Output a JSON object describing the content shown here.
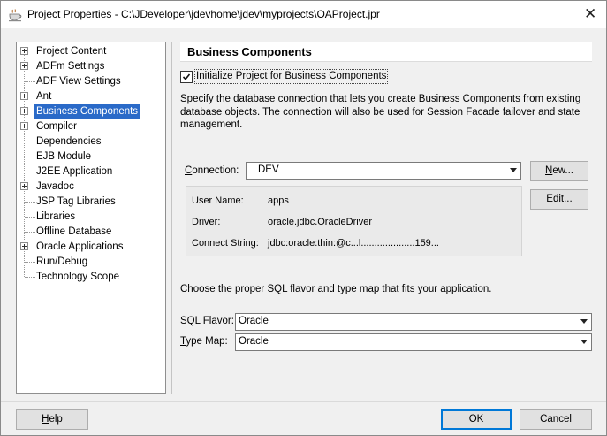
{
  "window": {
    "title": "Project Properties - C:\\JDeveloper\\jdevhome\\jdev\\myprojects\\OAProject.jpr",
    "close_glyph": "✕"
  },
  "tree": {
    "items": [
      {
        "label": "Project Content",
        "expandable": true
      },
      {
        "label": "ADFm Settings",
        "expandable": true
      },
      {
        "label": "ADF View Settings",
        "expandable": false
      },
      {
        "label": "Ant",
        "expandable": true
      },
      {
        "label": "Business Components",
        "expandable": true,
        "selected": true
      },
      {
        "label": "Compiler",
        "expandable": true
      },
      {
        "label": "Dependencies",
        "expandable": false
      },
      {
        "label": "EJB Module",
        "expandable": false
      },
      {
        "label": "J2EE Application",
        "expandable": false
      },
      {
        "label": "Javadoc",
        "expandable": true
      },
      {
        "label": "JSP Tag Libraries",
        "expandable": false
      },
      {
        "label": "Libraries",
        "expandable": false
      },
      {
        "label": "Offline Database",
        "expandable": false
      },
      {
        "label": "Oracle Applications",
        "expandable": true
      },
      {
        "label": "Run/Debug",
        "expandable": false
      },
      {
        "label": "Technology Scope",
        "expandable": false
      }
    ]
  },
  "panel": {
    "title": "Business Components",
    "init_checkbox": {
      "label": "Initialize Project for Business Components",
      "checked": true
    },
    "description": "Specify the database connection that lets you create Business Components from existing database objects.  The connection will also be used for Session Facade failover and state management.",
    "connection": {
      "label_pre": "",
      "label_mnemonic": "C",
      "label_post": "onnection:",
      "value": "DEV"
    },
    "new_button": {
      "mnemonic": "N",
      "rest": "ew..."
    },
    "edit_button": {
      "mnemonic": "E",
      "rest": "dit..."
    },
    "connection_info": {
      "user_name_label": "User Name:",
      "user_name_value": "apps",
      "driver_label": "Driver:",
      "driver_value": "oracle.jdbc.OracleDriver",
      "connect_string_label": "Connect String:",
      "connect_string_value": "jdbc:oracle:thin:@c...l....................159..."
    },
    "sql_hint": "Choose the proper SQL flavor and type map that fits your application.",
    "sql_flavor": {
      "label_mnemonic": "S",
      "label_post": "QL Flavor:",
      "value": "Oracle"
    },
    "type_map": {
      "label_mnemonic": "T",
      "label_post": "ype Map:",
      "value": "Oracle"
    }
  },
  "footer": {
    "help": {
      "mnemonic": "H",
      "rest": "elp"
    },
    "ok": "OK",
    "cancel": "Cancel"
  },
  "colors": {
    "selection": "#2a6ac8",
    "dialog_bg": "#f0f0f0",
    "button_bg": "#e1e1e1",
    "default_button_border": "#0078d7"
  }
}
